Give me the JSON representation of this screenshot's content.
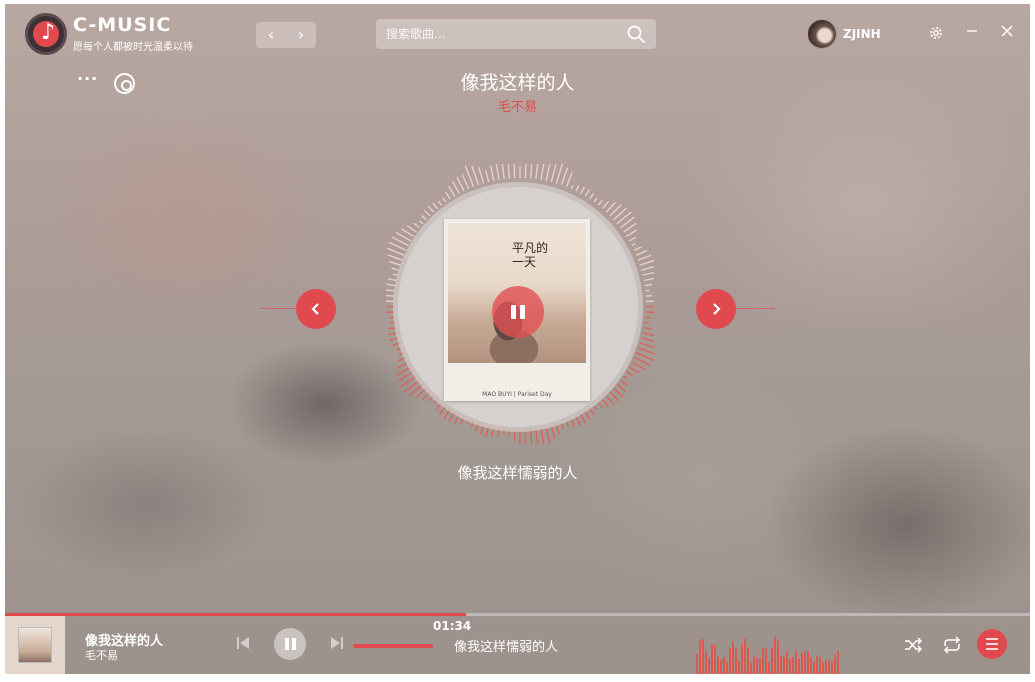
{
  "app": {
    "name": "C-MUSIC",
    "slogan": "愿每个人都被时光温柔以待",
    "logo_icon": "music-note-icon"
  },
  "header": {
    "back_label": "‹",
    "forward_label": "›",
    "search_placeholder": "搜索歌曲...",
    "username": "ZJINH"
  },
  "now_playing": {
    "title": "像我这样的人",
    "artist": "毛不易",
    "current_lyric": "像我这样懦弱的人",
    "cover_text": "平凡的一天",
    "cover_footer": "MAO BUYI  |  Pariset Day",
    "elapsed": "01:34",
    "progress": 0.45
  },
  "bottom_bar": {
    "title": "像我这样的人",
    "artist": "毛不易",
    "lyric": "像我这样懦弱的人"
  },
  "colors": {
    "accent": "#e0494e"
  }
}
